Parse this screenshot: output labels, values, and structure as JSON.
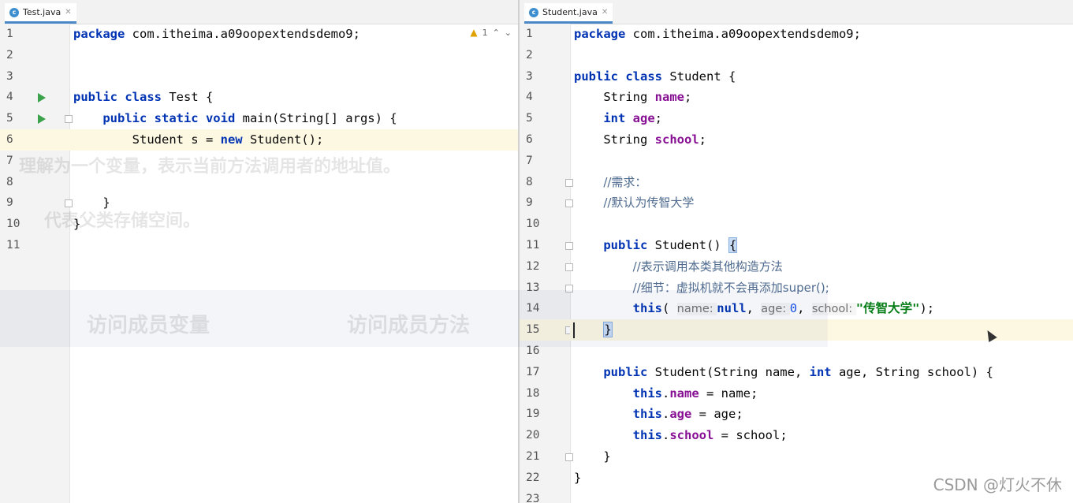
{
  "left": {
    "tab": {
      "icon": "java-class-icon",
      "label": "Test.java"
    },
    "warnings": {
      "count": "1"
    },
    "lines": [
      {
        "n": "1",
        "tokens": [
          {
            "t": "package ",
            "c": "kw"
          },
          {
            "t": "com.itheima.a09oopextendsdemo9;",
            "c": ""
          }
        ]
      },
      {
        "n": "2",
        "tokens": []
      },
      {
        "n": "3",
        "tokens": []
      },
      {
        "n": "4",
        "tokens": [
          {
            "t": "public class ",
            "c": "kw"
          },
          {
            "t": "Test {",
            "c": ""
          }
        ]
      },
      {
        "n": "5",
        "tokens": [
          {
            "t": "    public static void ",
            "c": "kw"
          },
          {
            "t": "main(String[] args) {",
            "c": ""
          }
        ]
      },
      {
        "n": "6",
        "tokens": [
          {
            "t": "        Student s = ",
            "c": ""
          },
          {
            "t": "new ",
            "c": "kw"
          },
          {
            "t": "Student();",
            "c": ""
          }
        ]
      },
      {
        "n": "7",
        "tokens": []
      },
      {
        "n": "8",
        "tokens": []
      },
      {
        "n": "9",
        "tokens": [
          {
            "t": "    }",
            "c": ""
          }
        ]
      },
      {
        "n": "10",
        "tokens": [
          {
            "t": "}",
            "c": ""
          }
        ]
      },
      {
        "n": "11",
        "tokens": []
      }
    ]
  },
  "right": {
    "tab": {
      "icon": "java-class-icon",
      "label": "Student.java"
    },
    "lines": [
      {
        "n": "1",
        "tokens": [
          {
            "t": "package ",
            "c": "kw"
          },
          {
            "t": "com.itheima.a09oopextendsdemo9;",
            "c": ""
          }
        ]
      },
      {
        "n": "2",
        "tokens": []
      },
      {
        "n": "3",
        "tokens": [
          {
            "t": "public class ",
            "c": "kw"
          },
          {
            "t": "Student {",
            "c": ""
          }
        ]
      },
      {
        "n": "4",
        "tokens": [
          {
            "t": "    String ",
            "c": ""
          },
          {
            "t": "name",
            "c": "fld"
          },
          {
            "t": ";",
            "c": ""
          }
        ]
      },
      {
        "n": "5",
        "tokens": [
          {
            "t": "    ",
            "c": ""
          },
          {
            "t": "int ",
            "c": "kw"
          },
          {
            "t": "age",
            "c": "fld"
          },
          {
            "t": ";",
            "c": ""
          }
        ]
      },
      {
        "n": "6",
        "tokens": [
          {
            "t": "    String ",
            "c": ""
          },
          {
            "t": "school",
            "c": "fld"
          },
          {
            "t": ";",
            "c": ""
          }
        ]
      },
      {
        "n": "7",
        "tokens": []
      },
      {
        "n": "8",
        "tokens": [
          {
            "t": "    ",
            "c": ""
          },
          {
            "t": "//需求：",
            "c": "cmt"
          }
        ]
      },
      {
        "n": "9",
        "tokens": [
          {
            "t": "    ",
            "c": ""
          },
          {
            "t": "//默认为传智大学",
            "c": "cmt"
          }
        ]
      },
      {
        "n": "10",
        "tokens": []
      },
      {
        "n": "11",
        "tokens": [
          {
            "t": "    ",
            "c": ""
          },
          {
            "t": "public ",
            "c": "kw"
          },
          {
            "t": "Student() ",
            "c": ""
          },
          {
            "t": "{",
            "c": "brace-match"
          }
        ]
      },
      {
        "n": "12",
        "tokens": [
          {
            "t": "        ",
            "c": ""
          },
          {
            "t": "//表示调用本类其他构造方法",
            "c": "cmt"
          }
        ]
      },
      {
        "n": "13",
        "tokens": [
          {
            "t": "        ",
            "c": ""
          },
          {
            "t": "//细节：虚拟机就不会再添加super();",
            "c": "cmt"
          }
        ]
      },
      {
        "n": "14",
        "tokens": [
          {
            "t": "        ",
            "c": ""
          },
          {
            "t": "this",
            "c": "kw"
          },
          {
            "t": "( ",
            "c": ""
          },
          {
            "t": "name: ",
            "c": "hint"
          },
          {
            "t": "null",
            "c": "kw"
          },
          {
            "t": ", ",
            "c": ""
          },
          {
            "t": "age: ",
            "c": "hint"
          },
          {
            "t": "0",
            "c": "num"
          },
          {
            "t": ", ",
            "c": ""
          },
          {
            "t": "school: ",
            "c": "hint"
          },
          {
            "t": "\"传智大学\"",
            "c": "str"
          },
          {
            "t": ");",
            "c": ""
          }
        ]
      },
      {
        "n": "15",
        "tokens": [
          {
            "t": "    ",
            "c": ""
          },
          {
            "t": "}",
            "c": "brace-match"
          }
        ]
      },
      {
        "n": "16",
        "tokens": []
      },
      {
        "n": "17",
        "tokens": [
          {
            "t": "    ",
            "c": ""
          },
          {
            "t": "public ",
            "c": "kw"
          },
          {
            "t": "Student(String name, ",
            "c": ""
          },
          {
            "t": "int ",
            "c": "kw"
          },
          {
            "t": "age, String school) {",
            "c": ""
          }
        ]
      },
      {
        "n": "18",
        "tokens": [
          {
            "t": "        ",
            "c": ""
          },
          {
            "t": "this",
            "c": "kw"
          },
          {
            "t": ".",
            "c": ""
          },
          {
            "t": "name",
            "c": "fld"
          },
          {
            "t": " = name;",
            "c": ""
          }
        ]
      },
      {
        "n": "19",
        "tokens": [
          {
            "t": "        ",
            "c": ""
          },
          {
            "t": "this",
            "c": "kw"
          },
          {
            "t": ".",
            "c": ""
          },
          {
            "t": "age",
            "c": "fld"
          },
          {
            "t": " = age;",
            "c": ""
          }
        ]
      },
      {
        "n": "20",
        "tokens": [
          {
            "t": "        ",
            "c": ""
          },
          {
            "t": "this",
            "c": "kw"
          },
          {
            "t": ".",
            "c": ""
          },
          {
            "t": "school",
            "c": "fld"
          },
          {
            "t": " = school;",
            "c": ""
          }
        ]
      },
      {
        "n": "21",
        "tokens": [
          {
            "t": "    }",
            "c": ""
          }
        ]
      },
      {
        "n": "22",
        "tokens": [
          {
            "t": "}",
            "c": ""
          }
        ]
      },
      {
        "n": "23",
        "tokens": []
      }
    ]
  },
  "ghost_overlay": [
    "理解为一个变量，表示当前方法调用者的地址值。",
    "代表父类存储空间。",
    "访问成员变量",
    "访问成员方法"
  ],
  "watermark": "CSDN @灯火不休",
  "colors": {
    "keyword": "#0033b3",
    "field": "#871094",
    "string": "#067d17",
    "number": "#1750eb",
    "comment": "#4e6a8f",
    "current_line": "#fdf8e2",
    "run_icon": "#3aa24a"
  }
}
